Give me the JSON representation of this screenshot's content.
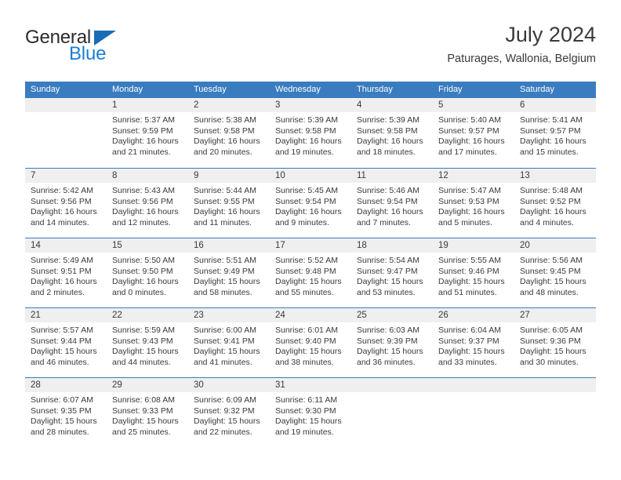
{
  "brand": {
    "name_part1": "General",
    "name_part2": "Blue",
    "accent_color": "#1b7ed6",
    "triangle_color": "#1b6cb5"
  },
  "header": {
    "title": "July 2024",
    "subtitle": "Paturages, Wallonia, Belgium"
  },
  "theme": {
    "header_row_bg": "#3a7cc0",
    "day_number_bg": "#efefef",
    "text_color": "#3a3a3a"
  },
  "weekdays": [
    "Sunday",
    "Monday",
    "Tuesday",
    "Wednesday",
    "Thursday",
    "Friday",
    "Saturday"
  ],
  "weeks": [
    [
      {
        "day": "",
        "sunrise": "",
        "sunset": "",
        "daylight_line1": "",
        "daylight_line2": ""
      },
      {
        "day": "1",
        "sunrise": "Sunrise: 5:37 AM",
        "sunset": "Sunset: 9:59 PM",
        "daylight_line1": "Daylight: 16 hours",
        "daylight_line2": "and 21 minutes."
      },
      {
        "day": "2",
        "sunrise": "Sunrise: 5:38 AM",
        "sunset": "Sunset: 9:58 PM",
        "daylight_line1": "Daylight: 16 hours",
        "daylight_line2": "and 20 minutes."
      },
      {
        "day": "3",
        "sunrise": "Sunrise: 5:39 AM",
        "sunset": "Sunset: 9:58 PM",
        "daylight_line1": "Daylight: 16 hours",
        "daylight_line2": "and 19 minutes."
      },
      {
        "day": "4",
        "sunrise": "Sunrise: 5:39 AM",
        "sunset": "Sunset: 9:58 PM",
        "daylight_line1": "Daylight: 16 hours",
        "daylight_line2": "and 18 minutes."
      },
      {
        "day": "5",
        "sunrise": "Sunrise: 5:40 AM",
        "sunset": "Sunset: 9:57 PM",
        "daylight_line1": "Daylight: 16 hours",
        "daylight_line2": "and 17 minutes."
      },
      {
        "day": "6",
        "sunrise": "Sunrise: 5:41 AM",
        "sunset": "Sunset: 9:57 PM",
        "daylight_line1": "Daylight: 16 hours",
        "daylight_line2": "and 15 minutes."
      }
    ],
    [
      {
        "day": "7",
        "sunrise": "Sunrise: 5:42 AM",
        "sunset": "Sunset: 9:56 PM",
        "daylight_line1": "Daylight: 16 hours",
        "daylight_line2": "and 14 minutes."
      },
      {
        "day": "8",
        "sunrise": "Sunrise: 5:43 AM",
        "sunset": "Sunset: 9:56 PM",
        "daylight_line1": "Daylight: 16 hours",
        "daylight_line2": "and 12 minutes."
      },
      {
        "day": "9",
        "sunrise": "Sunrise: 5:44 AM",
        "sunset": "Sunset: 9:55 PM",
        "daylight_line1": "Daylight: 16 hours",
        "daylight_line2": "and 11 minutes."
      },
      {
        "day": "10",
        "sunrise": "Sunrise: 5:45 AM",
        "sunset": "Sunset: 9:54 PM",
        "daylight_line1": "Daylight: 16 hours",
        "daylight_line2": "and 9 minutes."
      },
      {
        "day": "11",
        "sunrise": "Sunrise: 5:46 AM",
        "sunset": "Sunset: 9:54 PM",
        "daylight_line1": "Daylight: 16 hours",
        "daylight_line2": "and 7 minutes."
      },
      {
        "day": "12",
        "sunrise": "Sunrise: 5:47 AM",
        "sunset": "Sunset: 9:53 PM",
        "daylight_line1": "Daylight: 16 hours",
        "daylight_line2": "and 5 minutes."
      },
      {
        "day": "13",
        "sunrise": "Sunrise: 5:48 AM",
        "sunset": "Sunset: 9:52 PM",
        "daylight_line1": "Daylight: 16 hours",
        "daylight_line2": "and 4 minutes."
      }
    ],
    [
      {
        "day": "14",
        "sunrise": "Sunrise: 5:49 AM",
        "sunset": "Sunset: 9:51 PM",
        "daylight_line1": "Daylight: 16 hours",
        "daylight_line2": "and 2 minutes."
      },
      {
        "day": "15",
        "sunrise": "Sunrise: 5:50 AM",
        "sunset": "Sunset: 9:50 PM",
        "daylight_line1": "Daylight: 16 hours",
        "daylight_line2": "and 0 minutes."
      },
      {
        "day": "16",
        "sunrise": "Sunrise: 5:51 AM",
        "sunset": "Sunset: 9:49 PM",
        "daylight_line1": "Daylight: 15 hours",
        "daylight_line2": "and 58 minutes."
      },
      {
        "day": "17",
        "sunrise": "Sunrise: 5:52 AM",
        "sunset": "Sunset: 9:48 PM",
        "daylight_line1": "Daylight: 15 hours",
        "daylight_line2": "and 55 minutes."
      },
      {
        "day": "18",
        "sunrise": "Sunrise: 5:54 AM",
        "sunset": "Sunset: 9:47 PM",
        "daylight_line1": "Daylight: 15 hours",
        "daylight_line2": "and 53 minutes."
      },
      {
        "day": "19",
        "sunrise": "Sunrise: 5:55 AM",
        "sunset": "Sunset: 9:46 PM",
        "daylight_line1": "Daylight: 15 hours",
        "daylight_line2": "and 51 minutes."
      },
      {
        "day": "20",
        "sunrise": "Sunrise: 5:56 AM",
        "sunset": "Sunset: 9:45 PM",
        "daylight_line1": "Daylight: 15 hours",
        "daylight_line2": "and 48 minutes."
      }
    ],
    [
      {
        "day": "21",
        "sunrise": "Sunrise: 5:57 AM",
        "sunset": "Sunset: 9:44 PM",
        "daylight_line1": "Daylight: 15 hours",
        "daylight_line2": "and 46 minutes."
      },
      {
        "day": "22",
        "sunrise": "Sunrise: 5:59 AM",
        "sunset": "Sunset: 9:43 PM",
        "daylight_line1": "Daylight: 15 hours",
        "daylight_line2": "and 44 minutes."
      },
      {
        "day": "23",
        "sunrise": "Sunrise: 6:00 AM",
        "sunset": "Sunset: 9:41 PM",
        "daylight_line1": "Daylight: 15 hours",
        "daylight_line2": "and 41 minutes."
      },
      {
        "day": "24",
        "sunrise": "Sunrise: 6:01 AM",
        "sunset": "Sunset: 9:40 PM",
        "daylight_line1": "Daylight: 15 hours",
        "daylight_line2": "and 38 minutes."
      },
      {
        "day": "25",
        "sunrise": "Sunrise: 6:03 AM",
        "sunset": "Sunset: 9:39 PM",
        "daylight_line1": "Daylight: 15 hours",
        "daylight_line2": "and 36 minutes."
      },
      {
        "day": "26",
        "sunrise": "Sunrise: 6:04 AM",
        "sunset": "Sunset: 9:37 PM",
        "daylight_line1": "Daylight: 15 hours",
        "daylight_line2": "and 33 minutes."
      },
      {
        "day": "27",
        "sunrise": "Sunrise: 6:05 AM",
        "sunset": "Sunset: 9:36 PM",
        "daylight_line1": "Daylight: 15 hours",
        "daylight_line2": "and 30 minutes."
      }
    ],
    [
      {
        "day": "28",
        "sunrise": "Sunrise: 6:07 AM",
        "sunset": "Sunset: 9:35 PM",
        "daylight_line1": "Daylight: 15 hours",
        "daylight_line2": "and 28 minutes."
      },
      {
        "day": "29",
        "sunrise": "Sunrise: 6:08 AM",
        "sunset": "Sunset: 9:33 PM",
        "daylight_line1": "Daylight: 15 hours",
        "daylight_line2": "and 25 minutes."
      },
      {
        "day": "30",
        "sunrise": "Sunrise: 6:09 AM",
        "sunset": "Sunset: 9:32 PM",
        "daylight_line1": "Daylight: 15 hours",
        "daylight_line2": "and 22 minutes."
      },
      {
        "day": "31",
        "sunrise": "Sunrise: 6:11 AM",
        "sunset": "Sunset: 9:30 PM",
        "daylight_line1": "Daylight: 15 hours",
        "daylight_line2": "and 19 minutes."
      },
      {
        "day": "",
        "sunrise": "",
        "sunset": "",
        "daylight_line1": "",
        "daylight_line2": ""
      },
      {
        "day": "",
        "sunrise": "",
        "sunset": "",
        "daylight_line1": "",
        "daylight_line2": ""
      },
      {
        "day": "",
        "sunrise": "",
        "sunset": "",
        "daylight_line1": "",
        "daylight_line2": ""
      }
    ]
  ]
}
